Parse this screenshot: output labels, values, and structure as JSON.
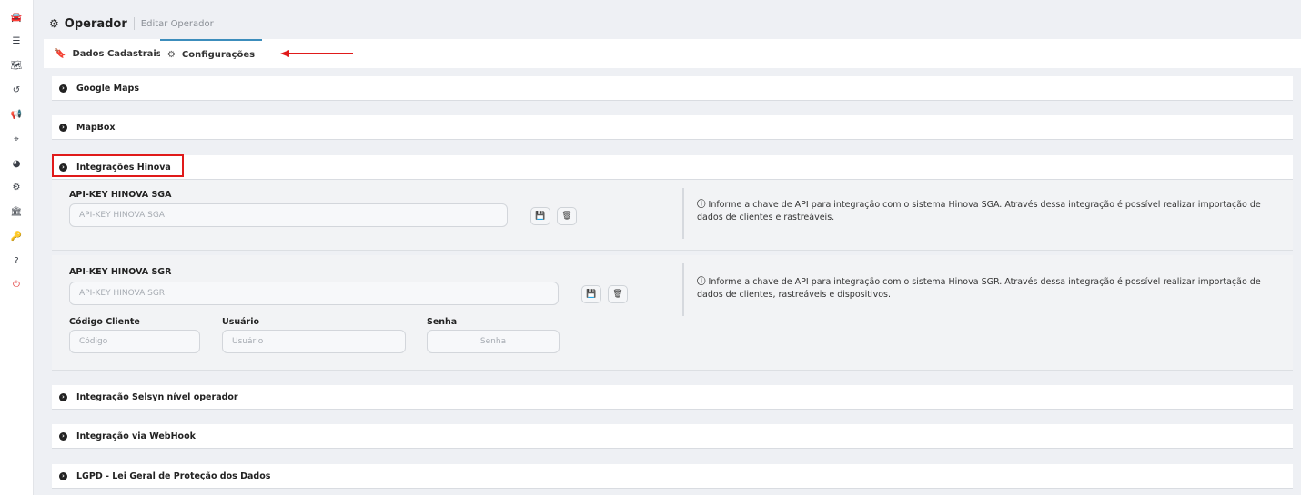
{
  "sidebar": {
    "icons": [
      {
        "name": "dashboard-icon",
        "glyph": "🚘"
      },
      {
        "name": "list-icon",
        "glyph": "☰"
      },
      {
        "name": "map-icon",
        "glyph": "🗺"
      },
      {
        "name": "history-icon",
        "glyph": "↺"
      },
      {
        "name": "bullhorn-icon",
        "glyph": "📢"
      },
      {
        "name": "crosshair-icon",
        "glyph": "⌖"
      },
      {
        "name": "pie-chart-icon",
        "glyph": "◕"
      },
      {
        "name": "cogs-icon",
        "glyph": "⚙"
      },
      {
        "name": "bank-icon",
        "glyph": "🏛"
      },
      {
        "name": "key-icon",
        "glyph": "🔑"
      },
      {
        "name": "help-icon",
        "glyph": "?"
      },
      {
        "name": "power-icon",
        "glyph": "⏻"
      }
    ]
  },
  "header": {
    "gear_glyph": "⚙",
    "title": "Operador",
    "subtitle": "Editar Operador"
  },
  "tabs": [
    {
      "label": "Dados Cadastrais",
      "icon": "bookmark-icon",
      "glyph": "🔖"
    },
    {
      "label": "Configurações",
      "icon": "gear-icon",
      "glyph": "⚙"
    }
  ],
  "panels": {
    "google_maps": "Google Maps",
    "mapbox": "MapBox",
    "hinova": "Integrações Hinova",
    "selsyn": "Integração Selsyn nível operador",
    "webhook": "Integração via WebHook",
    "lgpd": "LGPD - Lei Geral de Proteção dos Dados"
  },
  "panel_glyph": "›",
  "hinova_sga": {
    "label": "API-KEY HINOVA SGA",
    "placeholder": "API-KEY HINOVA SGA",
    "value": "",
    "info_icon": "ⓘ",
    "info_line1": "Informe a chave de API para integração com o sistema Hinova SGA. Através dessa integração é possível realizar importação de",
    "info_line2": "dados de clientes e rastreáveis."
  },
  "hinova_sgr": {
    "label": "API-KEY HINOVA SGR",
    "placeholder": "API-KEY HINOVA SGR",
    "value": "",
    "info_icon": "ⓘ",
    "info_line1": "Informe a chave de API para integração com o sistema Hinova SGR. Através dessa integração é possível realizar importação de",
    "info_line2": "dados de clientes, rastreáveis e dispositivos.",
    "codigo_label": "Código Cliente",
    "codigo_placeholder": "Código",
    "usuario_label": "Usuário",
    "usuario_placeholder": "Usuário",
    "senha_label": "Senha",
    "senha_placeholder": "Senha"
  },
  "buttons": {
    "save_glyph": "💾",
    "delete_glyph": "🗑"
  },
  "colors": {
    "highlight": "#e01a1a",
    "active_tab": "#3c8dbc",
    "power": "#e23a3a"
  }
}
